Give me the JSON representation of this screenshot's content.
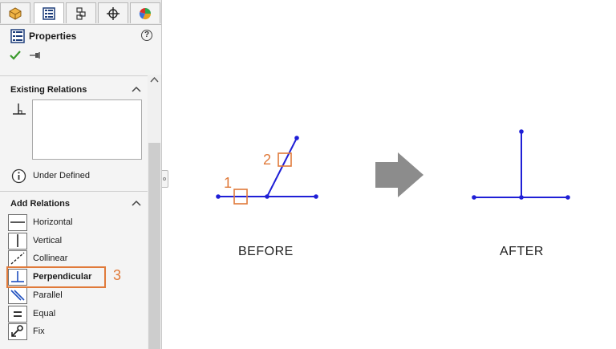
{
  "panel": {
    "title": "Properties",
    "help_glyph": "?",
    "existing_relations": {
      "heading": "Existing Relations"
    },
    "status": "Under Defined",
    "add_relations": {
      "heading": "Add Relations",
      "items": [
        {
          "label": "Horizontal",
          "icon": "horizontal-icon"
        },
        {
          "label": "Vertical",
          "icon": "vertical-icon"
        },
        {
          "label": "Collinear",
          "icon": "collinear-icon"
        },
        {
          "label": "Perpendicular",
          "icon": "perpendicular-icon"
        },
        {
          "label": "Parallel",
          "icon": "parallel-icon"
        },
        {
          "label": "Equal",
          "icon": "equal-icon"
        },
        {
          "label": "Fix",
          "icon": "fix-icon"
        }
      ]
    }
  },
  "callouts": {
    "one": "1",
    "two": "2",
    "three": "3"
  },
  "diagram": {
    "before_label": "BEFORE",
    "after_label": "AFTER"
  },
  "colors": {
    "accent": "#e07a3a",
    "sketch": "#1f1fd6",
    "arrow": "#8c8c8c"
  }
}
